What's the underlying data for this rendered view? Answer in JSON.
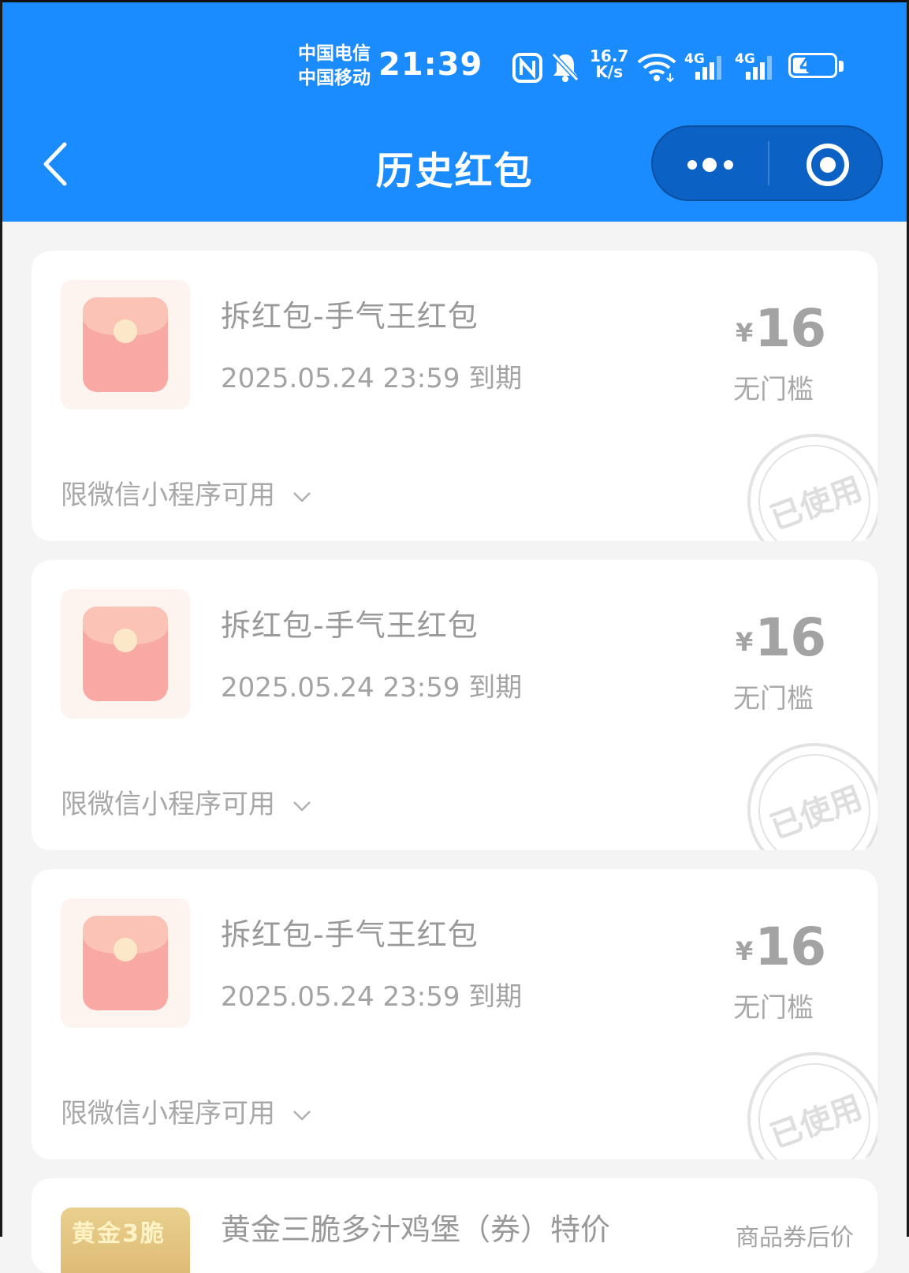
{
  "status_bar": {
    "carrier_1": "中国电信",
    "carrier_2": "中国移动",
    "time": "21:39",
    "speed_value": "16.7",
    "speed_unit": "K/s",
    "signal_1_label": "4G",
    "signal_2_label": "4G",
    "battery": "47",
    "battery_level_percent": 47,
    "icons": [
      "nfc-icon",
      "mute-bell-icon",
      "wifi-icon",
      "signal-icon",
      "signal-icon",
      "battery-icon"
    ]
  },
  "header": {
    "title": "历史红包",
    "back_icon": "chevron-left-icon",
    "more_icon": "more-dots-icon",
    "close_icon": "target-close-icon"
  },
  "colors": {
    "header_bg": "#1a8cff",
    "page_bg": "#f4f4f4",
    "card_bg": "#ffffff",
    "muted_text": "#a3a3a3",
    "packet_red": "#f9a9a3"
  },
  "coupons": [
    {
      "title": "拆红包-手气王红包",
      "expire": "2025.05.24 23:59 到期",
      "currency": "¥",
      "amount": "16",
      "threshold": "无门槛",
      "scope": "限微信小程序可用",
      "stamp": "已使用"
    },
    {
      "title": "拆红包-手气王红包",
      "expire": "2025.05.24 23:59 到期",
      "currency": "¥",
      "amount": "16",
      "threshold": "无门槛",
      "scope": "限微信小程序可用",
      "stamp": "已使用"
    },
    {
      "title": "拆红包-手气王红包",
      "expire": "2025.05.24 23:59 到期",
      "currency": "¥",
      "amount": "16",
      "threshold": "无门槛",
      "scope": "限微信小程序可用",
      "stamp": "已使用"
    }
  ],
  "partial_coupon": {
    "thumb_text": "黄金3脆",
    "title": "黄金三脆多汁鸡堡（券）特价",
    "price_label": "商品券后价"
  }
}
